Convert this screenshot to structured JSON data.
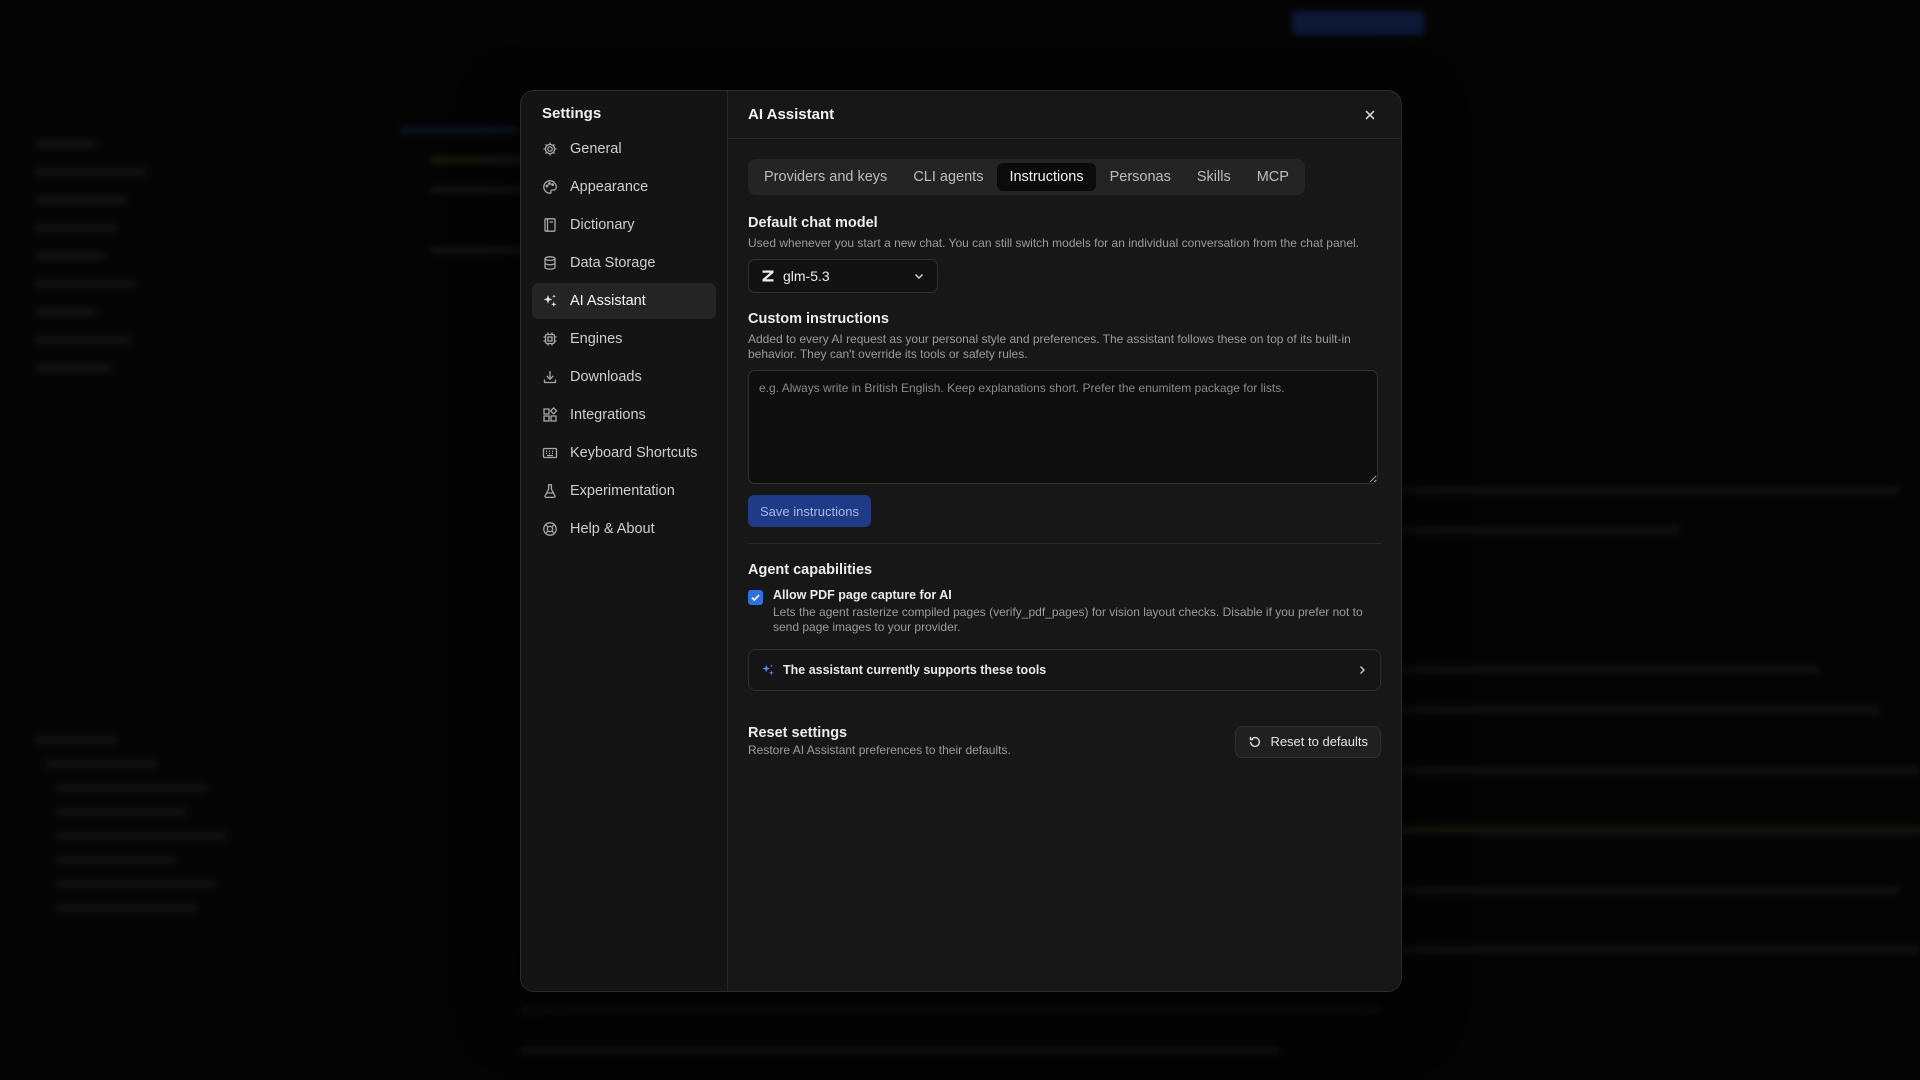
{
  "settings": {
    "title": "Settings",
    "nav": [
      {
        "label": "General",
        "icon": "gear-icon"
      },
      {
        "label": "Appearance",
        "icon": "palette-icon"
      },
      {
        "label": "Dictionary",
        "icon": "book-icon"
      },
      {
        "label": "Data Storage",
        "icon": "database-icon"
      },
      {
        "label": "AI Assistant",
        "icon": "sparkles-icon",
        "active": true
      },
      {
        "label": "Engines",
        "icon": "cpu-icon"
      },
      {
        "label": "Downloads",
        "icon": "download-icon"
      },
      {
        "label": "Integrations",
        "icon": "puzzle-icon"
      },
      {
        "label": "Keyboard Shortcuts",
        "icon": "keyboard-icon"
      },
      {
        "label": "Experimentation",
        "icon": "flask-icon"
      },
      {
        "label": "Help & About",
        "icon": "lifebuoy-icon"
      }
    ]
  },
  "panel": {
    "title": "AI Assistant",
    "tabs": [
      "Providers and keys",
      "CLI agents",
      "Instructions",
      "Personas",
      "Skills",
      "MCP"
    ],
    "active_tab": "Instructions",
    "default_model": {
      "title": "Default chat model",
      "description": "Used whenever you start a new chat. You can still switch models for an individual conversation from the chat panel.",
      "selected": "glm-5.3"
    },
    "custom_instructions": {
      "title": "Custom instructions",
      "description": "Added to every AI request as your personal style and preferences. The assistant follows these on top of its built-in behavior. They can't override its tools or safety rules.",
      "placeholder": "e.g. Always write in British English. Keep explanations short. Prefer the enumitem package for lists.",
      "value": "",
      "save_label": "Save instructions"
    },
    "agent_capabilities": {
      "title": "Agent capabilities",
      "pdf_capture_label": "Allow PDF page capture for AI",
      "pdf_capture_desc": "Lets the agent rasterize compiled pages (verify_pdf_pages) for vision layout checks. Disable if you prefer not to send page images to your provider.",
      "pdf_capture_checked": true,
      "tools_label": "The assistant currently supports these tools"
    },
    "reset": {
      "title": "Reset settings",
      "description": "Restore AI Assistant preferences to their defaults.",
      "button_label": "Reset to defaults"
    }
  },
  "colors": {
    "accent": "#2f6fe0",
    "save_button_bg": "#1f3a87",
    "modal_bg": "#171717"
  }
}
